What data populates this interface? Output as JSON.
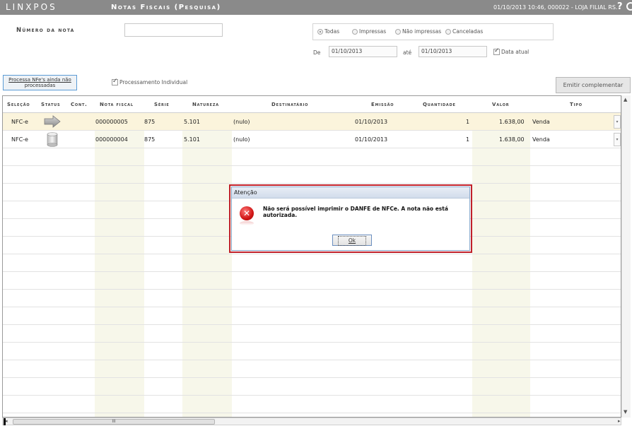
{
  "titlebar": {
    "brand": "LINXPOS",
    "title": "Notas Fiscais (Pesquisa)",
    "info": "01/10/2013 10:46, 000022 - LOJA FILIAL RS.",
    "help": "?"
  },
  "filters": {
    "numero_label": "Número da nota",
    "numero_value": "",
    "radios": [
      {
        "label": "Todas",
        "selected": true
      },
      {
        "label": "Impressas",
        "selected": false
      },
      {
        "label": "Não impressas",
        "selected": false
      },
      {
        "label": "Canceladas",
        "selected": false
      }
    ],
    "de_label": "De",
    "de_value": "01/10/2013",
    "ate_label": "até",
    "ate_value": "01/10/2013",
    "data_atual_label": "Data atual",
    "data_atual_checked": true,
    "processamento_individual_label": "Processamento Individual",
    "processamento_individual_checked": true
  },
  "buttons": {
    "processa_line1": "Processa NFe's ainda não",
    "processa_line2": "processadas",
    "emitir": "Emitir complementar"
  },
  "grid": {
    "columns": [
      "Seleção",
      "Status",
      "Cont.",
      "Nota fiscal",
      "Série",
      "Natureza",
      "Destinatário",
      "Emissão",
      "Quantidade",
      "Valor",
      "Tipo"
    ],
    "rows": [
      {
        "selecao": "NFC-e",
        "status_icon": "arrow-right-icon",
        "cont": "",
        "nota": "000000005",
        "serie": "875",
        "natureza": "5.101",
        "destinatario": "(nulo)",
        "emissao": "01/10/2013",
        "quantidade": "1",
        "valor": "1.638,00",
        "tipo": "Venda"
      },
      {
        "selecao": "NFC-e",
        "status_icon": "database-icon",
        "cont": "",
        "nota": "000000004",
        "serie": "875",
        "natureza": "5.101",
        "destinatario": "(nulo)",
        "emissao": "01/10/2013",
        "quantidade": "1",
        "valor": "1.638,00",
        "tipo": "Venda"
      }
    ],
    "hscroll_thumb": "III"
  },
  "dialog": {
    "title": "Atenção",
    "message": "Não será possível imprimir o DANFE de NFCe. A nota não está autorizada.",
    "ok": "Ok",
    "icon": "error-icon"
  },
  "colors": {
    "titlebar": "#8a8a8a",
    "selected_row": "#fbf4dc",
    "dialog_highlight": "#c0202a",
    "error_icon": "#d01515"
  }
}
